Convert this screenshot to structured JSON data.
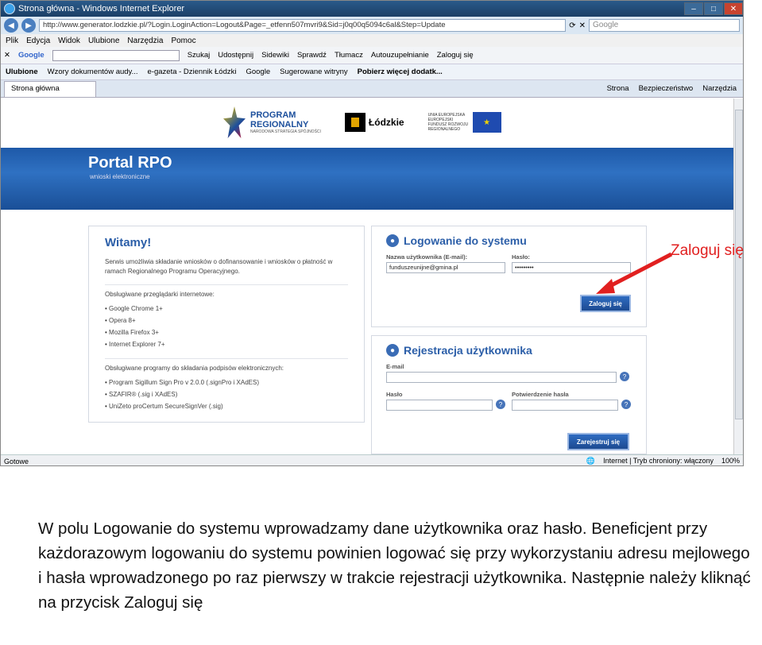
{
  "window": {
    "title": "Strona główna - Windows Internet Explorer"
  },
  "address": {
    "url": "http://www.generator.lodzkie.pl/?Login.LoginAction=Logout&Page=_etfenn507mvri9&Sid=j0q00q5094c6al&Step=Update",
    "search_placeholder": "Google"
  },
  "menu": [
    "Plik",
    "Edycja",
    "Widok",
    "Ulubione",
    "Narzędzia",
    "Pomoc"
  ],
  "google_toolbar": {
    "logo": "Google",
    "items": [
      "Szukaj",
      "Udostępnij",
      "Sidewiki",
      "Sprawdź",
      "Tłumacz",
      "Autouzupełnianie",
      "Zaloguj się"
    ]
  },
  "favorites": {
    "label": "Ulubione",
    "items": [
      "Wzory dokumentów audy...",
      "e-gazeta - Dziennik Łódzki",
      "Google",
      "Sugerowane witryny",
      "Pobierz więcej dodatk..."
    ]
  },
  "tab": {
    "label": "Strona główna",
    "right": [
      "Strona",
      "Bezpieczeństwo",
      "Narzędzia"
    ]
  },
  "logos": {
    "program": "PROGRAM",
    "regionalny": "REGIONALNY",
    "prsub": "NARODOWA STRATEGIA SPÓJNOŚCI",
    "lodzkie": "Łódzkie",
    "ue": "UNIA EUROPEJSKA EUROPEJSKI FUNDUSZ ROZWOJU REGIONALNEGO"
  },
  "banner": {
    "title": "Portal RPO",
    "subtitle": "wnioski elektroniczne"
  },
  "welcome": {
    "title": "Witamy!",
    "text": "Serwis umożliwia składanie wniosków o dofinansowanie i wniosków o płatność w ramach Regionalnego Programu Operacyjnego.",
    "browsers_header": "Obsługiwane przeglądarki internetowe:",
    "browsers": [
      "Google Chrome 1+",
      "Opera 8+",
      "Mozilla Firefox 3+",
      "Internet Explorer 7+"
    ],
    "sign_header": "Obsługiwane programy do składania podpisów elektronicznych:",
    "sign": [
      "Program Sigillum Sign Pro v 2.0.0 (.signPro i XAdES)",
      "SZAFIR® (.sig i XAdES)",
      "UniZeto proCertum SecureSignVer (.sig)"
    ]
  },
  "login": {
    "title": "Logowanie do systemu",
    "user_label": "Nazwa użytkownika (E-mail):",
    "user_value": "funduszeunijne@gmina.pl",
    "pass_label": "Hasło:",
    "pass_value": "•••••••••",
    "button": "Zaloguj się"
  },
  "register": {
    "title": "Rejestracja użytkownika",
    "email_label": "E-mail",
    "pass_label": "Hasło",
    "confirm_label": "Potwierdzenie hasła",
    "button": "Zarejestruj się"
  },
  "status": {
    "left": "Gotowe",
    "zone": "Internet | Tryb chroniony: włączony",
    "zoom": "100%"
  },
  "callout": "Zaloguj się",
  "caption": "W polu Logowanie do systemu wprowadzamy dane użytkownika oraz hasło. Beneficjent przy każdorazowym logowaniu do systemu powinien logować się przy wykorzystaniu adresu mejlowego i hasła wprowadzonego  po raz pierwszy w trakcie rejestracji użytkownika. Następnie należy kliknąć na przycisk Zaloguj się",
  "colors": {
    "accent": "#2b5ea8",
    "callout": "#e12020"
  }
}
